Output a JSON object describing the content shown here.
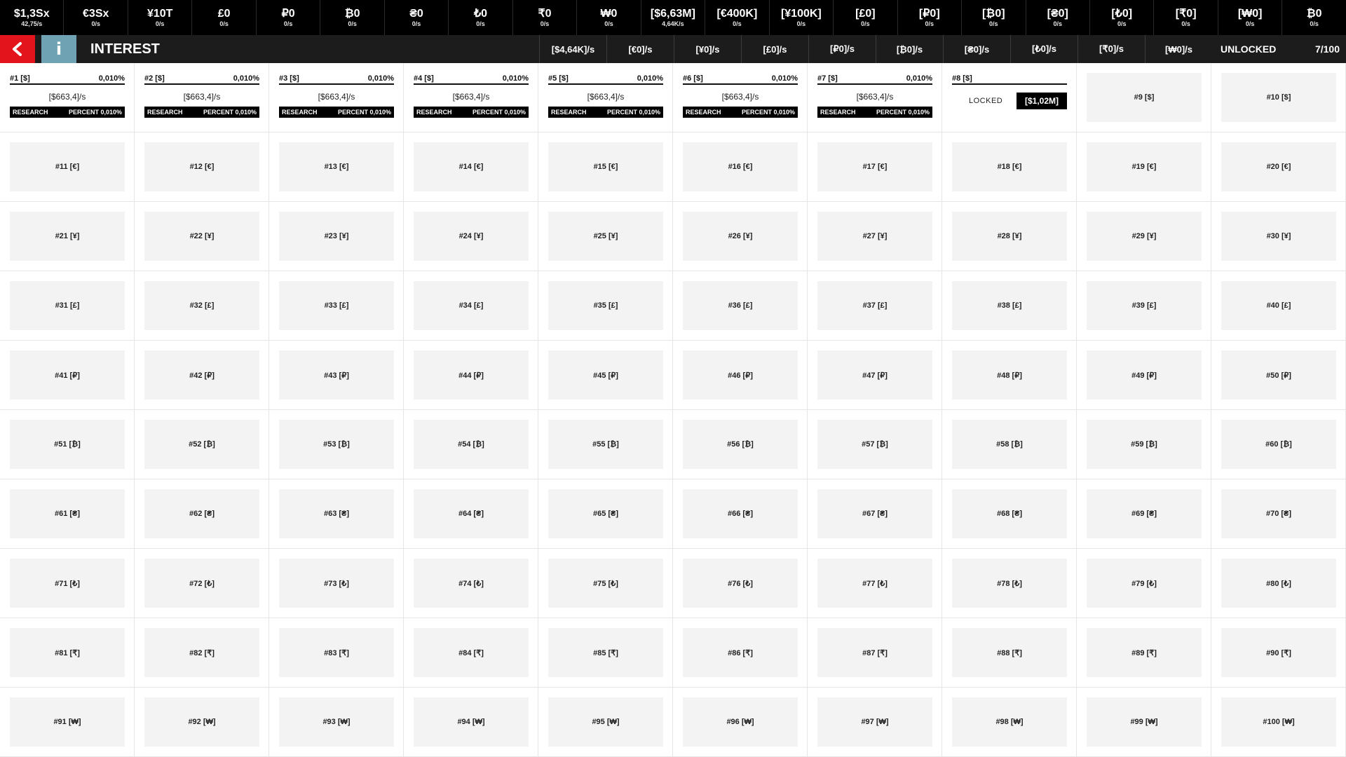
{
  "currencies": [
    {
      "value": "$1,3Sx",
      "rate": "42,75/s"
    },
    {
      "value": "€3Sx",
      "rate": "0/s"
    },
    {
      "value": "¥10T",
      "rate": "0/s"
    },
    {
      "value": "£0",
      "rate": "0/s"
    },
    {
      "value": "₽0",
      "rate": "0/s"
    },
    {
      "value": "₿0",
      "rate": "0/s"
    },
    {
      "value": "₴0",
      "rate": "0/s"
    },
    {
      "value": "₺0",
      "rate": "0/s"
    },
    {
      "value": "₹0",
      "rate": "0/s"
    },
    {
      "value": "₩0",
      "rate": "0/s"
    },
    {
      "value": "[$6,63M]",
      "rate": "4,64K/s"
    },
    {
      "value": "[€400K]",
      "rate": "0/s"
    },
    {
      "value": "[¥100K]",
      "rate": "0/s"
    },
    {
      "value": "[£0]",
      "rate": "0/s"
    },
    {
      "value": "[₽0]",
      "rate": "0/s"
    },
    {
      "value": "[₿0]",
      "rate": "0/s"
    },
    {
      "value": "[₴0]",
      "rate": "0/s"
    },
    {
      "value": "[₺0]",
      "rate": "0/s"
    },
    {
      "value": "[₹0]",
      "rate": "0/s"
    },
    {
      "value": "[₩0]",
      "rate": "0/s"
    },
    {
      "value": "₿0",
      "rate": "0/s"
    }
  ],
  "header": {
    "back_icon": "chevron-left-icon",
    "info_icon": "info-icon",
    "info_glyph": "i",
    "title": "INTEREST",
    "rate_tabs": [
      "[$4,64K]/s",
      "[€0]/s",
      "[¥0]/s",
      "[£0]/s",
      "[₽0]/s",
      "[₿0]/s",
      "[₴0]/s",
      "[₺0]/s",
      "[₹0]/s",
      "[₩0]/s"
    ],
    "unlocked_label": "UNLOCKED",
    "unlocked_count": "7/100"
  },
  "unlocked_tiles": [
    {
      "title": "#1 [$]",
      "percent": "0,010%",
      "rate": "[$663,4]/s",
      "research": "RESEARCH",
      "percent_label": "PERCENT 0,010%"
    },
    {
      "title": "#2 [$]",
      "percent": "0,010%",
      "rate": "[$663,4]/s",
      "research": "RESEARCH",
      "percent_label": "PERCENT 0,010%"
    },
    {
      "title": "#3 [$]",
      "percent": "0,010%",
      "rate": "[$663,4]/s",
      "research": "RESEARCH",
      "percent_label": "PERCENT 0,010%"
    },
    {
      "title": "#4 [$]",
      "percent": "0,010%",
      "rate": "[$663,4]/s",
      "research": "RESEARCH",
      "percent_label": "PERCENT 0,010%"
    },
    {
      "title": "#5 [$]",
      "percent": "0,010%",
      "rate": "[$663,4]/s",
      "research": "RESEARCH",
      "percent_label": "PERCENT 0,010%"
    },
    {
      "title": "#6 [$]",
      "percent": "0,010%",
      "rate": "[$663,4]/s",
      "research": "RESEARCH",
      "percent_label": "PERCENT 0,010%"
    },
    {
      "title": "#7 [$]",
      "percent": "0,010%",
      "rate": "[$663,4]/s",
      "research": "RESEARCH",
      "percent_label": "PERCENT 0,010%"
    }
  ],
  "locked_tile": {
    "title": "#8 [$]",
    "label": "LOCKED",
    "price": "[$1,02M]"
  },
  "tiles": [
    "#9 [$]",
    "#10 [$]",
    "#11 [€]",
    "#12 [€]",
    "#13 [€]",
    "#14 [€]",
    "#15 [€]",
    "#16 [€]",
    "#17 [€]",
    "#18 [€]",
    "#19 [€]",
    "#20 [€]",
    "#21 [¥]",
    "#22 [¥]",
    "#23 [¥]",
    "#24 [¥]",
    "#25 [¥]",
    "#26 [¥]",
    "#27 [¥]",
    "#28 [¥]",
    "#29 [¥]",
    "#30 [¥]",
    "#31 [£]",
    "#32 [£]",
    "#33 [£]",
    "#34 [£]",
    "#35 [£]",
    "#36 [£]",
    "#37 [£]",
    "#38 [£]",
    "#39 [£]",
    "#40 [£]",
    "#41 [₽]",
    "#42 [₽]",
    "#43 [₽]",
    "#44 [₽]",
    "#45 [₽]",
    "#46 [₽]",
    "#47 [₽]",
    "#48 [₽]",
    "#49 [₽]",
    "#50 [₽]",
    "#51 [₿]",
    "#52 [₿]",
    "#53 [₿]",
    "#54 [₿]",
    "#55 [₿]",
    "#56 [₿]",
    "#57 [₿]",
    "#58 [₿]",
    "#59 [₿]",
    "#60 [₿]",
    "#61 [₴]",
    "#62 [₴]",
    "#63 [₴]",
    "#64 [₴]",
    "#65 [₴]",
    "#66 [₴]",
    "#67 [₴]",
    "#68 [₴]",
    "#69 [₴]",
    "#70 [₴]",
    "#71 [₺]",
    "#72 [₺]",
    "#73 [₺]",
    "#74 [₺]",
    "#75 [₺]",
    "#76 [₺]",
    "#77 [₺]",
    "#78 [₺]",
    "#79 [₺]",
    "#80 [₺]",
    "#81 [₹]",
    "#82 [₹]",
    "#83 [₹]",
    "#84 [₹]",
    "#85 [₹]",
    "#86 [₹]",
    "#87 [₹]",
    "#88 [₹]",
    "#89 [₹]",
    "#90 [₹]",
    "#91 [₩]",
    "#92 [₩]",
    "#93 [₩]",
    "#94 [₩]",
    "#95 [₩]",
    "#96 [₩]",
    "#97 [₩]",
    "#98 [₩]",
    "#99 [₩]",
    "#100 [₩]"
  ],
  "colors": {
    "accent_back": "#e3141b",
    "accent_info": "#6fa3b3",
    "bar_background": "#000000",
    "title_bar": "#1c1c1c",
    "tile_background": "#f3f3f3"
  }
}
